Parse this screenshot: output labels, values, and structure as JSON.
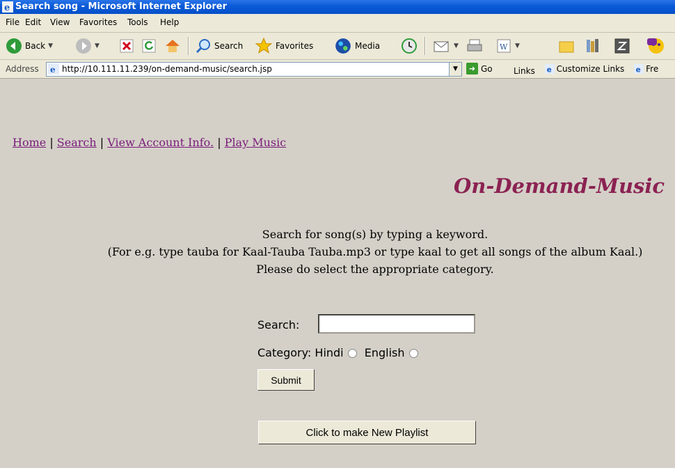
{
  "window": {
    "title": "Search song - Microsoft Internet Explorer"
  },
  "menu": [
    "File",
    "Edit",
    "View",
    "Favorites",
    "Tools",
    "Help"
  ],
  "toolbar": {
    "back": "Back",
    "search": "Search",
    "favorites": "Favorites",
    "media": "Media"
  },
  "address": {
    "label": "Address",
    "url": "http://10.111.11.239/on-demand-music/search.jsp",
    "go": "Go",
    "links": "Links",
    "customize": "Customize Links",
    "free": "Fre"
  },
  "page": {
    "nav": {
      "home": "Home",
      "search": "Search",
      "account": "View Account Info.",
      "play": "Play Music",
      "separator": " | "
    },
    "brand": "On-Demand-Music",
    "instructions": [
      "Search for song(s) by typing a keyword.",
      "(For e.g. type tauba for Kaal-Tauba Tauba.mp3 or type kaal to get all songs of the album Kaal.)",
      "Please do select the appropriate category."
    ],
    "form": {
      "search_label": "Search:",
      "search_value": "",
      "category_label": "Category:",
      "hindi": "Hindi",
      "english": "English",
      "submit": "Submit"
    },
    "playlist_button": "Click to make New Playlist"
  }
}
